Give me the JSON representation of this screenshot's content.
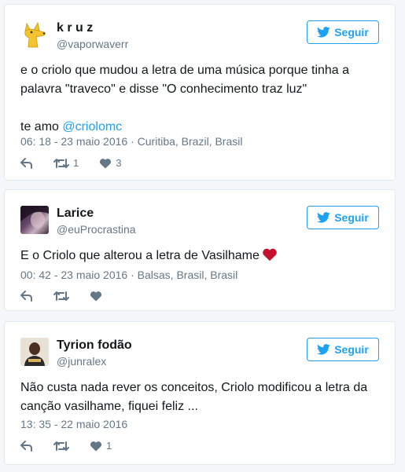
{
  "accent_color": "#1da1f2",
  "tweets": [
    {
      "name": "k r u z",
      "handle": "@vaporwaverr",
      "follow_label": "Seguir",
      "text_line1": "e o criolo que mudou a letra de uma música porque tinha a",
      "text_line2": "palavra \"traveco\" e disse \"O conhecimento traz luz\"",
      "text_line3_prefix": "te amo ",
      "mention": "@criolomc",
      "meta": "06: 18 - 23 maio 2016 · Curitiba, Brazil, Brasil",
      "retweets": "1",
      "likes": "3",
      "avatar": "yellow-fox-avatar"
    },
    {
      "name": "Larice",
      "handle": "@euProcrastina",
      "follow_label": "Seguir",
      "text": "E o Criolo que alterou a letra de Vasilhame",
      "text_emoji": "red-heart-icon",
      "meta": "00: 42 - 23 maio 2016 · Balsas, Brasil, Brasil",
      "retweets": "",
      "likes": "",
      "avatar": "photo-avatar"
    },
    {
      "name": "Tyrion fodão",
      "handle": "@junralex",
      "follow_label": "Seguir",
      "text_line1": "Não custa nada rever os conceitos, Criolo modificou a letra da",
      "text_line2": "canção vasilhame, fiquei feliz ...",
      "meta": "13: 35 - 22 maio 2016",
      "retweets": "",
      "likes": "1",
      "avatar": "photo-avatar"
    }
  ]
}
